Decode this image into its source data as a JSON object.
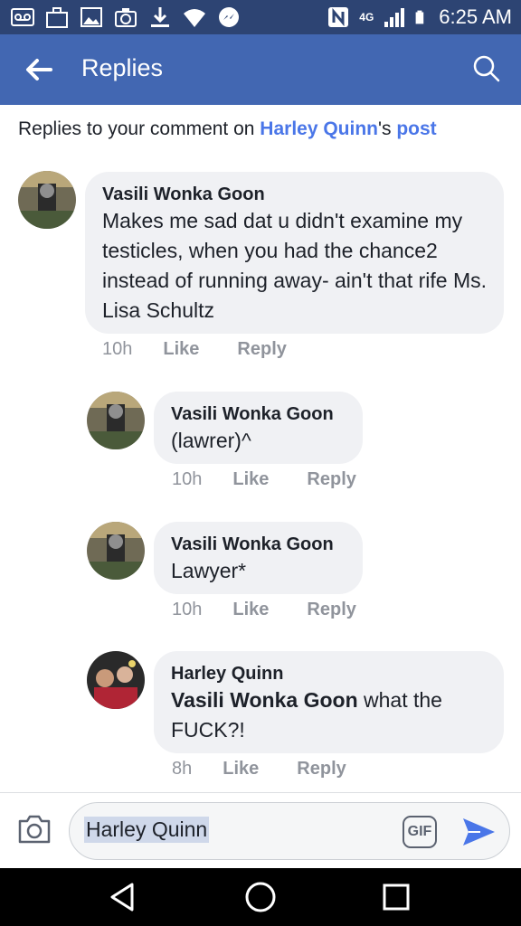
{
  "status_bar": {
    "time": "6:25 AM",
    "network_label": "4G",
    "icons": [
      "voicemail-icon",
      "briefcase-icon",
      "image-icon",
      "camera-icon",
      "download-icon",
      "wifi-icon",
      "messenger-icon",
      "nfc-icon",
      "network-4g-icon",
      "signal-icon",
      "battery-icon"
    ]
  },
  "header": {
    "title": "Replies",
    "back_icon": "arrow-left-icon",
    "search_icon": "search-icon",
    "color": "#4267b2"
  },
  "context": {
    "prefix": "Replies to your comment on ",
    "person": "Harley Quinn",
    "possessive": "'s ",
    "post": "post"
  },
  "comments": [
    {
      "author": "Vasili Wonka Goon",
      "text": "Makes me sad dat u didn't examine my testicles, when you had the chance2 instead of running away- ain't that rife Ms. Lisa Schultz",
      "time": "10h",
      "like": "Like",
      "reply": "Reply"
    },
    {
      "author": "Vasili Wonka Goon",
      "text": "(lawrer)^",
      "time": "10h",
      "like": "Like",
      "reply": "Reply"
    },
    {
      "author": "Vasili Wonka Goon",
      "text": "Lawyer*",
      "time": "10h",
      "like": "Like",
      "reply": "Reply"
    },
    {
      "author": "Harley Quinn",
      "mention": "Vasili Wonka Goon",
      "text": " what the FUCK?!",
      "time": "8h",
      "like": "Like",
      "reply": "Reply"
    }
  ],
  "composer": {
    "value": "Harley Quinn",
    "gif_label": "GIF"
  },
  "colors": {
    "link": "#4a76e8",
    "bubble": "#f0f1f4",
    "muted": "#90949c"
  }
}
